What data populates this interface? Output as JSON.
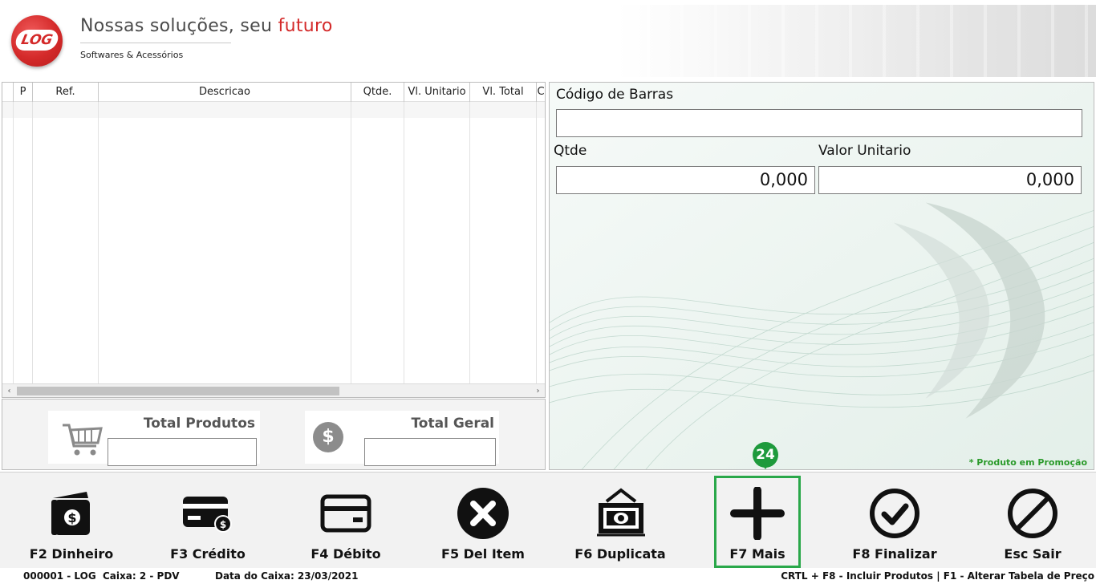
{
  "header": {
    "logo_text": "LOG",
    "tagline_prefix": "Nossas soluções, seu ",
    "tagline_accent": "futuro",
    "subtitle": "Softwares & Acessórios"
  },
  "grid": {
    "columns": [
      "",
      "P",
      "Ref.",
      "Descricao",
      "Qtde.",
      "Vl. Unitario",
      "Vl. Total",
      "C"
    ]
  },
  "totals": {
    "produtos_label": "Total Produtos",
    "produtos_value": "",
    "geral_label": "Total Geral",
    "geral_value": "",
    "currency_symbol": "$"
  },
  "entry": {
    "barcode_label": "Código de Barras",
    "barcode_value": "",
    "qtde_label": "Qtde",
    "qtde_value": "0,000",
    "valor_label": "Valor Unitario",
    "valor_value": "0,000",
    "promo_note": "* Produto em Promoção"
  },
  "toolbar": {
    "buttons": [
      {
        "label": "F2 Dinheiro",
        "icon": "cash-icon"
      },
      {
        "label": "F3 Crédito",
        "icon": "credit-card-icon"
      },
      {
        "label": "F4 Débito",
        "icon": "debit-card-icon"
      },
      {
        "label": "F5 Del Item",
        "icon": "delete-circle-icon"
      },
      {
        "label": "F6 Duplicata",
        "icon": "invoice-icon"
      },
      {
        "label": "F7 Mais",
        "icon": "plus-icon"
      },
      {
        "label": "F8 Finalizar",
        "icon": "check-circle-icon"
      },
      {
        "label": "Esc Sair",
        "icon": "prohibited-icon"
      }
    ],
    "highlight_badge": "24",
    "highlight_color": "#2aa84a"
  },
  "status": {
    "operator": "000001 - LOG",
    "caixa": "Caixa: 2 - PDV",
    "data_caixa": "Data do Caixa: 23/03/2021",
    "shortcuts": "CRTL + F8 - Incluir Produtos | F1 - Alterar Tabela de Preço"
  }
}
